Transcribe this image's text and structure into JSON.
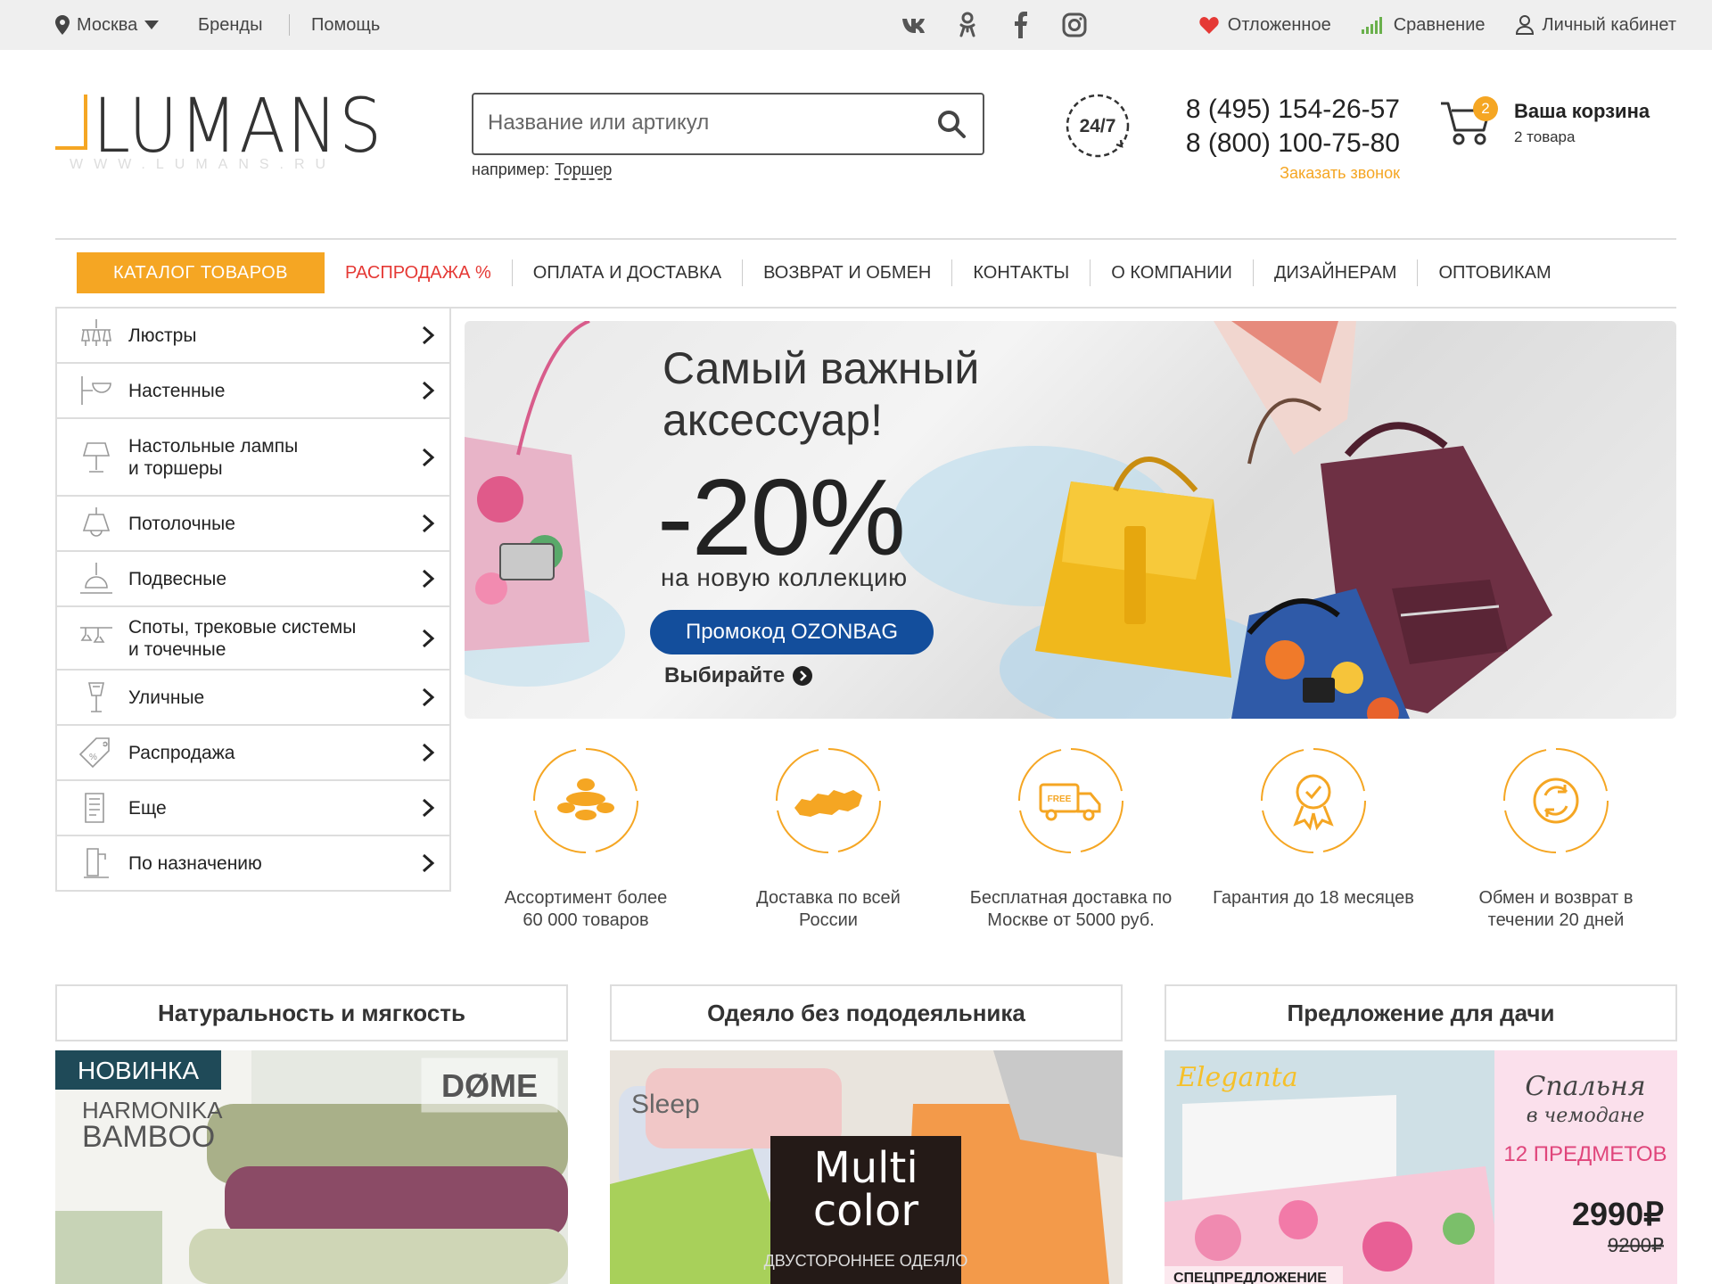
{
  "topbar": {
    "city": "Москва",
    "brands": "Бренды",
    "help": "Помощь",
    "social": [
      "vk-icon",
      "odnoklassniki-icon",
      "facebook-icon",
      "instagram-icon"
    ],
    "favorites": "Отложенное",
    "compare": "Сравнение",
    "account": "Личный кабинет"
  },
  "header": {
    "logo": "LUMANS",
    "logo_sub": "WWW.LUMANS.RU",
    "search_placeholder": "Название или артикул",
    "search_hint_prefix": "например:",
    "search_hint_example": "Торшер",
    "badge": "24/7",
    "phone1": "8 (495) 154-26-57",
    "phone2": "8 (800) 100-75-80",
    "callback": "Заказать звонок",
    "cart_title": "Ваша корзина",
    "cart_sub": "2 товара",
    "cart_count": "2"
  },
  "nav": {
    "catalog": "КАТАЛОГ ТОВАРОВ",
    "items": [
      "РАСПРОДАЖА %",
      "ОПЛАТА И ДОСТАВКА",
      "ВОЗВРАТ И ОБМЕН",
      "КОНТАКТЫ",
      "О КОМПАНИИ",
      "ДИЗАЙНЕРАМ",
      "ОПТОВИКАМ"
    ]
  },
  "sidebar": {
    "items": [
      {
        "label": "Люстры",
        "label2": "",
        "icon": "chandelier-icon"
      },
      {
        "label": "Настенные",
        "label2": "",
        "icon": "wall-lamp-icon"
      },
      {
        "label": "Настольные лампы",
        "label2": "и торшеры",
        "icon": "table-lamp-icon"
      },
      {
        "label": "Потолочные",
        "label2": "",
        "icon": "ceiling-lamp-icon"
      },
      {
        "label": "Подвесные",
        "label2": "",
        "icon": "pendant-lamp-icon"
      },
      {
        "label": "Споты, трековые системы",
        "label2": "и точечные",
        "icon": "spotlight-icon"
      },
      {
        "label": "Уличные",
        "label2": "",
        "icon": "street-lamp-icon"
      },
      {
        "label": "Распродажа",
        "label2": "",
        "icon": "sale-tag-icon"
      },
      {
        "label": "Еще",
        "label2": "",
        "icon": "more-icon"
      },
      {
        "label": "По назначению",
        "label2": "",
        "icon": "purpose-icon"
      }
    ]
  },
  "banner": {
    "headline1": "Самый важный",
    "headline2": "аксессуар!",
    "discount": "-20%",
    "subline": "на новую коллекцию",
    "promo": "Промокод OZONBAG",
    "cta": "Выбирайте"
  },
  "features": [
    {
      "line1": "Ассортимент более",
      "line2": "60 000 товаров",
      "icon": "chandelier-icon"
    },
    {
      "line1": "Доставка по всей",
      "line2": "России",
      "icon": "russia-map-icon"
    },
    {
      "line1": "Бесплатная доставка по",
      "line2": "Москве от 5000 руб.",
      "icon": "free-delivery-truck-icon"
    },
    {
      "line1": "Гарантия до 18 месяцев",
      "line2": "",
      "icon": "guarantee-medal-icon"
    },
    {
      "line1": "Обмен и возврат в",
      "line2": "течении 20 дней",
      "icon": "exchange-icon"
    }
  ],
  "cards": [
    {
      "title": "Натуральность и мягкость",
      "tag1": "НОВИНКА",
      "tag2": "HARMONIKA",
      "tag3": "BAMBOO",
      "brand": "DØME"
    },
    {
      "title": "Одеяло без пододеяльника",
      "brand": "Sleep",
      "tag1": "Multi",
      "tag2": "color",
      "tag3": "ДВУСТОРОННЕЕ ОДЕЯЛО"
    },
    {
      "title": "Предложение для дачи",
      "brand": "Eleganta",
      "tag1": "Спальня",
      "tag2": "в чемодане",
      "tag3": "12 ПРЕДМЕТОВ",
      "price": "2990₽",
      "old_price": "9200₽",
      "corner": "СПЕЦПРЕДЛОЖЕНИЕ"
    }
  ],
  "colors": {
    "accent": "#f5a623",
    "sale": "#e53935",
    "promo": "#134e9c"
  }
}
